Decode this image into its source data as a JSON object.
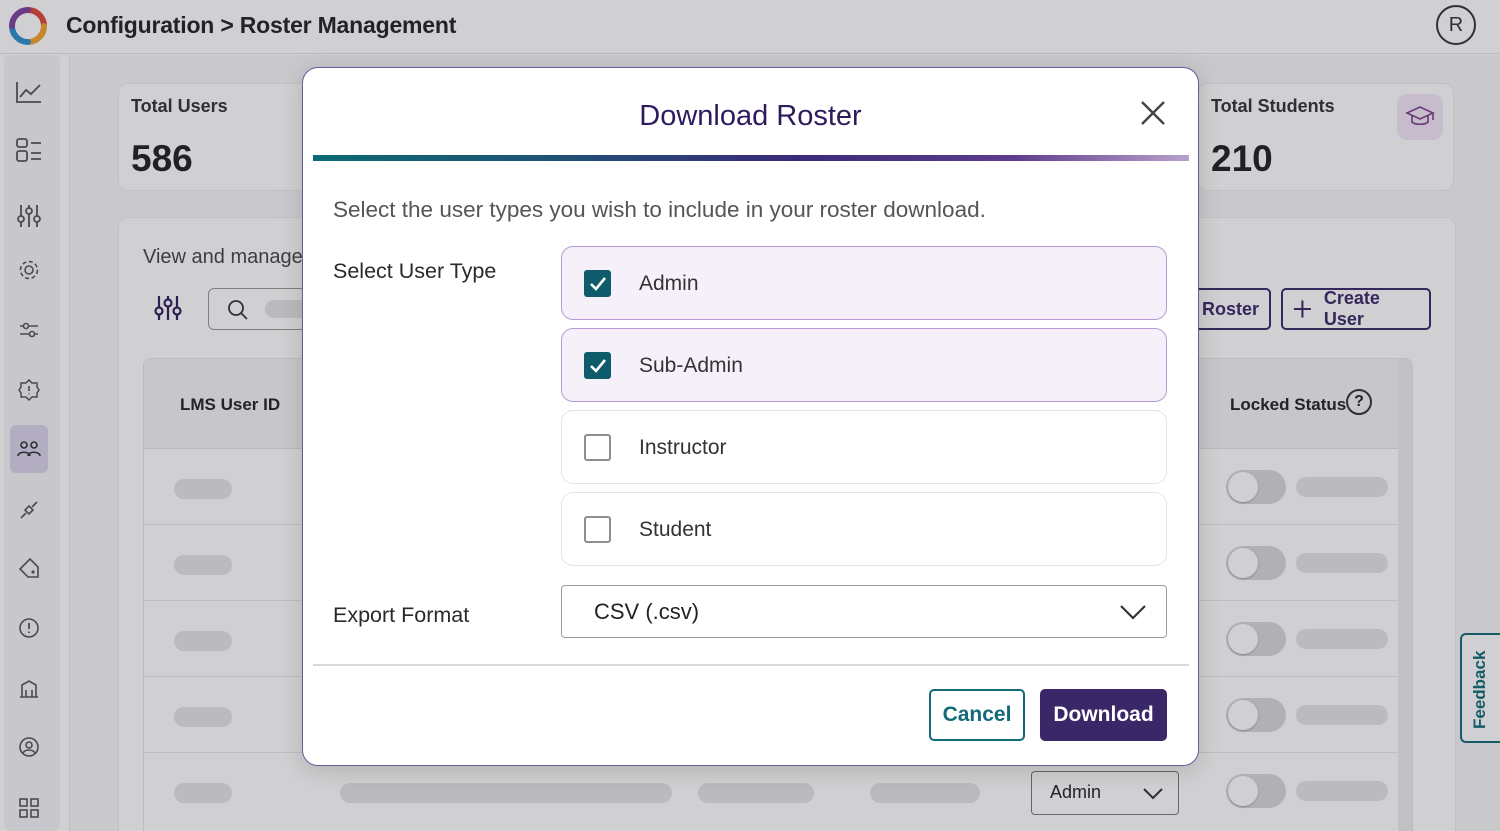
{
  "header": {
    "breadcrumb": "Configuration > Roster Management",
    "avatar_initial": "R"
  },
  "stats": {
    "total_users_label": "Total Users",
    "total_users_value": "586",
    "total_students_label": "Total Students",
    "total_students_value": "210"
  },
  "panel": {
    "subtitle": "View and manage",
    "roster_button": "Roster",
    "create_user_button": "Create User",
    "columns": {
      "lms_user_id": "LMS User ID",
      "locked_status": "Locked Status"
    },
    "row_role_value": "Admin"
  },
  "feedback_label": "Feedback",
  "modal": {
    "title": "Download Roster",
    "instruction": "Select the user types you wish to include in your roster download.",
    "user_type_label": "Select User Type",
    "options": [
      {
        "label": "Admin",
        "checked": true
      },
      {
        "label": "Sub-Admin",
        "checked": true
      },
      {
        "label": "Instructor",
        "checked": false
      },
      {
        "label": "Student",
        "checked": false
      }
    ],
    "export_format_label": "Export Format",
    "export_format_value": "CSV (.csv)",
    "cancel_label": "Cancel",
    "download_label": "Download"
  },
  "colors": {
    "primary_purple": "#3a2768",
    "teal": "#136a77",
    "checked_bg": "#f6f0fb",
    "checkbox_fill": "#0e5c6b"
  }
}
